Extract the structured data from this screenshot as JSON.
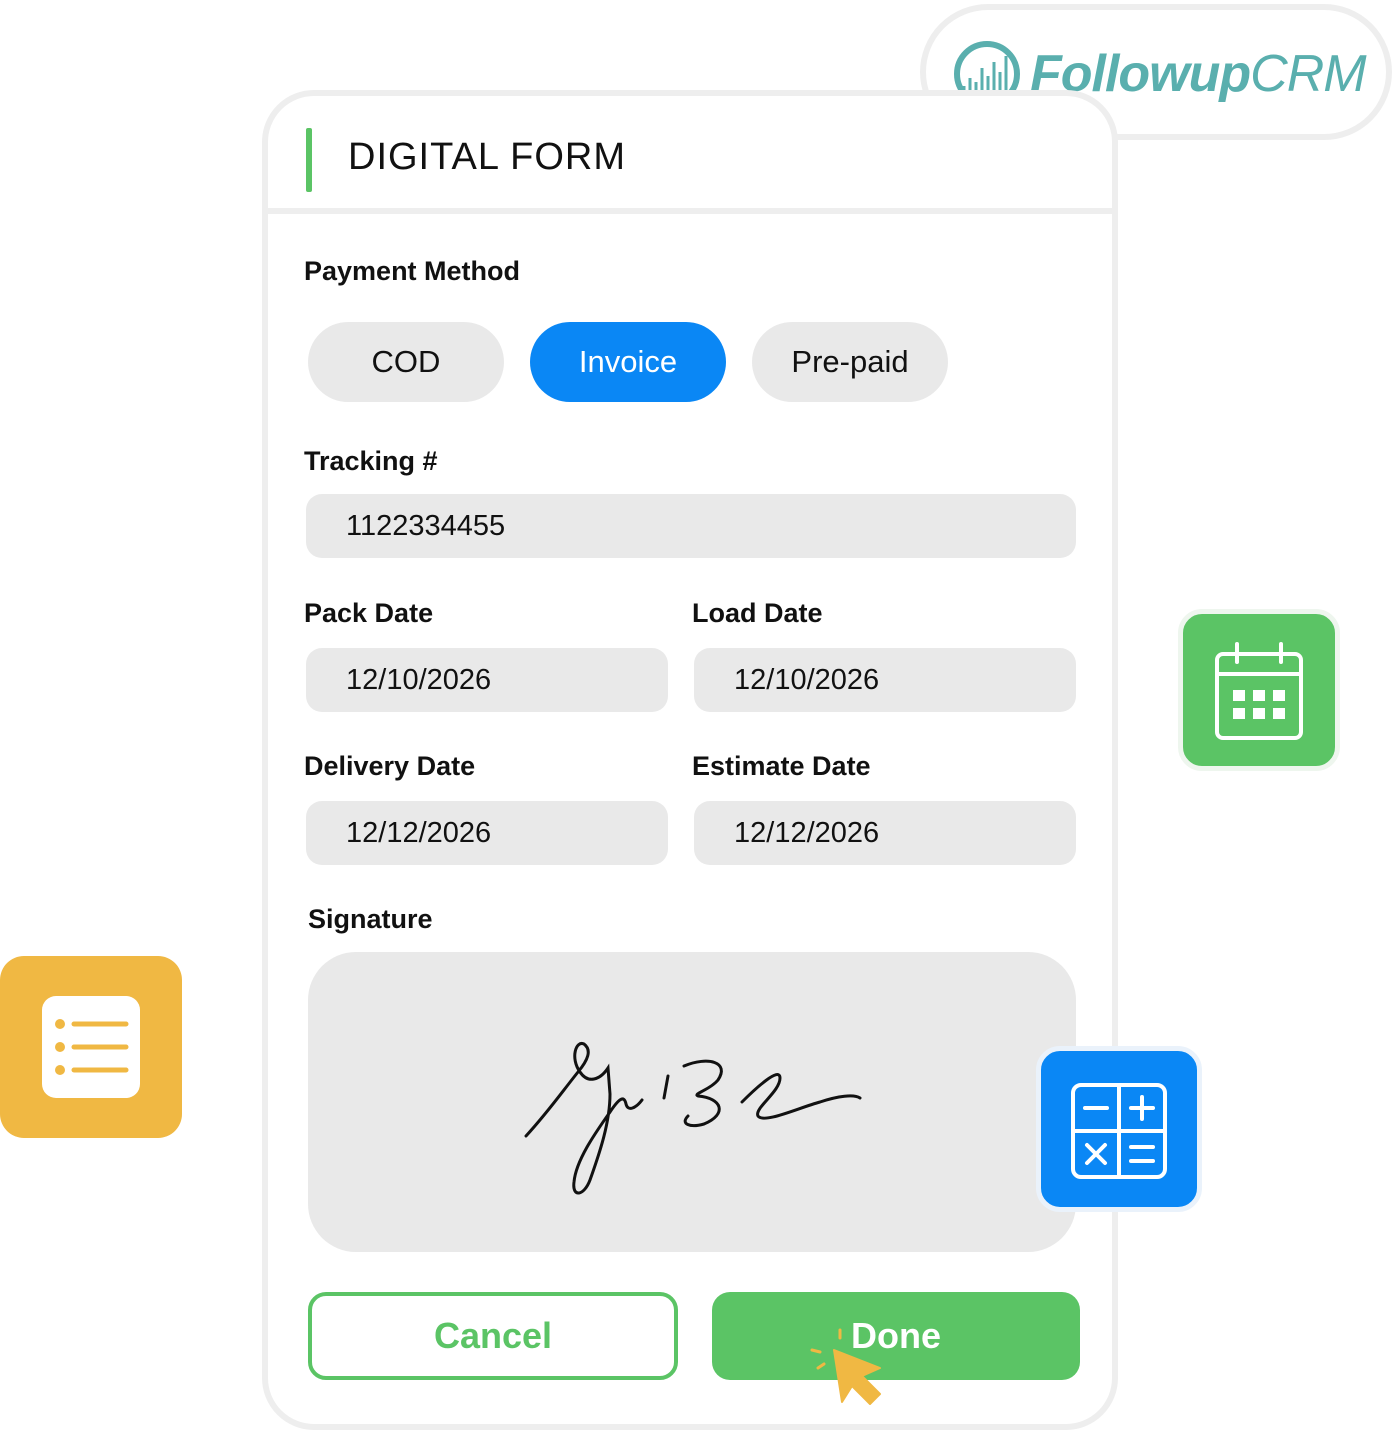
{
  "brand": {
    "name_bold": "Followup",
    "name_light": "CRM"
  },
  "form": {
    "title": "DIGITAL FORM",
    "payment": {
      "label": "Payment Method",
      "options": [
        "COD",
        "Invoice",
        "Pre-paid"
      ],
      "selected": "Invoice"
    },
    "tracking": {
      "label": "Tracking #",
      "value": "1122334455"
    },
    "pack_date": {
      "label": "Pack Date",
      "value": "12/10/2026"
    },
    "load_date": {
      "label": "Load Date",
      "value": "12/10/2026"
    },
    "delivery_date": {
      "label": "Delivery Date",
      "value": "12/12/2026"
    },
    "estimate_date": {
      "label": "Estimate Date",
      "value": "12/12/2026"
    },
    "signature": {
      "label": "Signature"
    },
    "actions": {
      "cancel": "Cancel",
      "done": "Done"
    }
  },
  "icons": [
    "calendar-icon",
    "calculator-icon",
    "list-icon",
    "cursor-icon",
    "logo-icon"
  ],
  "colors": {
    "accent_green": "#5bc465",
    "accent_blue": "#0a87f5",
    "accent_yellow": "#f0b843",
    "brand_teal": "#5aafae"
  }
}
